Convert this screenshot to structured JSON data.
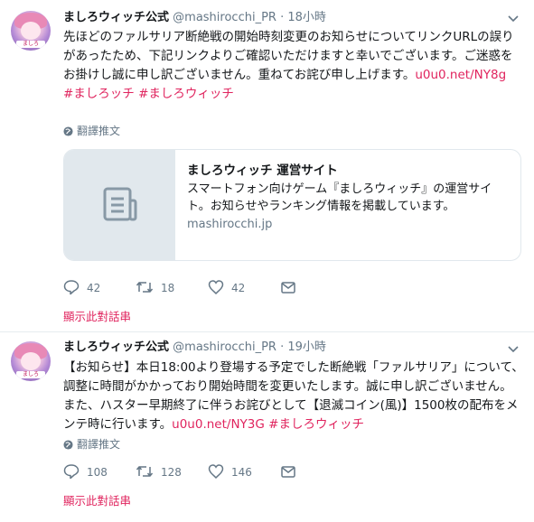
{
  "tweets": [
    {
      "display_name": "ましろウィッチ公式",
      "handle": "@mashirocchi_PR",
      "separator": "·",
      "time": "18小時",
      "text": "先ほどのファルサリア断絶戦の開始時刻変更のお知らせについてリンクURLの誤りがあったため、下記リンクよりご確認いただけますと幸いでございます。ご迷惑をお掛けし誠に申し訳ございません。重ねてお詫び申し上げます。",
      "link": "u0u0.net/NY8g",
      "hashtags": "#ましろッチ #ましろウィッチ",
      "translate_label": "翻譯推文",
      "card": {
        "title": "ましろウィッチ 運営サイト",
        "description": "スマートフォン向けゲーム『ましろウィッチ』の運営サイト。お知らせやランキング情報を掲載しています。",
        "url": "mashirocchi.jp"
      },
      "replies": "42",
      "retweets": "18",
      "likes": "42",
      "thread_label": "顯示此對話串"
    },
    {
      "display_name": "ましろウィッチ公式",
      "handle": "@mashirocchi_PR",
      "separator": "·",
      "time": "19小時",
      "text": "【お知らせ】本日18:00より登場する予定でした断絶戦「ファルサリア」について、調整に時間がかかっており開始時間を変更いたします。誠に申し訳ございません。また、ハスター早期終了に伴うお詫びとして【退滅コイン(風)】1500枚の配布をメンテ時に行います。",
      "link": "u0u0.net/NY3G",
      "hashtags": "#ましろウィッチ",
      "translate_label": "翻譯推文",
      "replies": "108",
      "retweets": "128",
      "likes": "146",
      "thread_label": "顯示此對話串"
    }
  ],
  "colors": {
    "accent": "#e0245e",
    "muted": "#657786",
    "border": "#e1e8ed"
  }
}
